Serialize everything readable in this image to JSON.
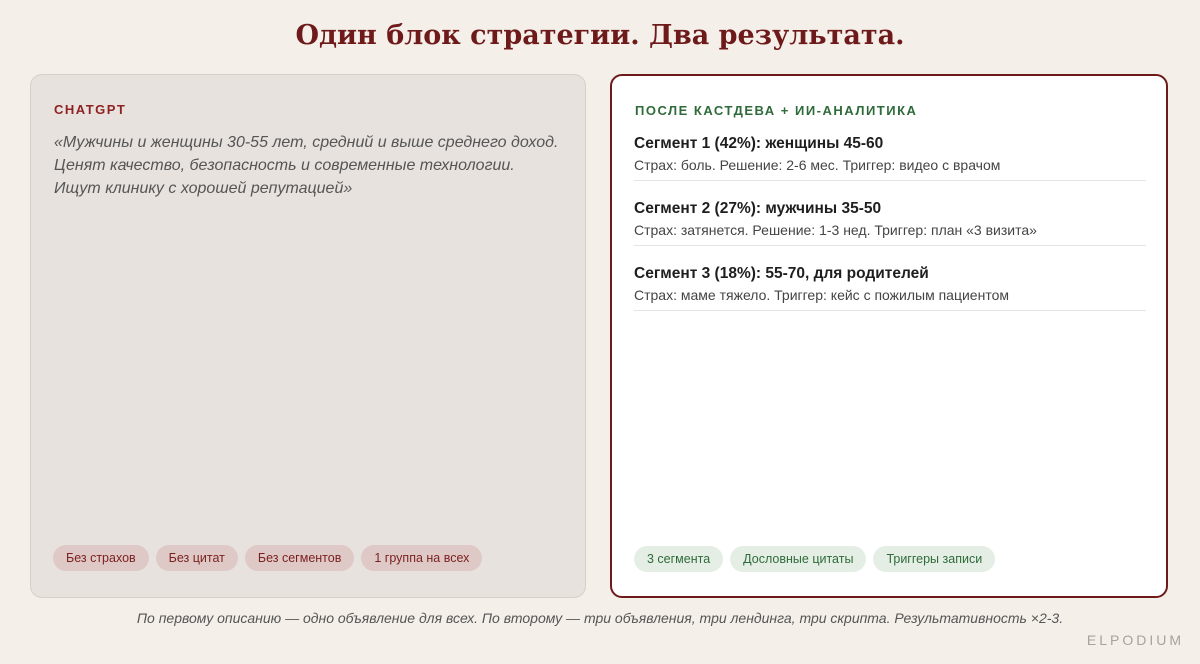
{
  "title": "Один блок стратегии. Два результата.",
  "left": {
    "label": "CHATGPT",
    "quote": "«Мужчины и женщины 30-55 лет, средний и выше среднего доход. Ценят качество, безопасность и современные технологии. Ищут клинику с хорошей репутацией»",
    "tags": [
      "Без страхов",
      "Без цитат",
      "Без сегментов",
      "1 группа на всех"
    ]
  },
  "right": {
    "label": "ПОСЛЕ КАСТДЕВА + ИИ-АНАЛИТИКА",
    "segments": [
      {
        "title": "Сегмент 1 (42%): женщины 45-60",
        "desc": "Страх: боль. Решение: 2-6 мес. Триггер: видео с врачом"
      },
      {
        "title": "Сегмент 2 (27%): мужчины 35-50",
        "desc": "Страх: затянется. Решение: 1-3 нед. Триггер: план «3 визита»"
      },
      {
        "title": "Сегмент 3 (18%): 55-70, для родителей",
        "desc": "Страх: маме тяжело. Триггер: кейс с пожилым пациентом"
      }
    ],
    "tags": [
      "3 сегмента",
      "Дословные цитаты",
      "Триггеры записи"
    ]
  },
  "footnote": "По первому описанию — одно объявление для всех. По второму — три объявления, три лендинга, три скрипта. Результативность ×2-3.",
  "brand": "ELPODIUM"
}
